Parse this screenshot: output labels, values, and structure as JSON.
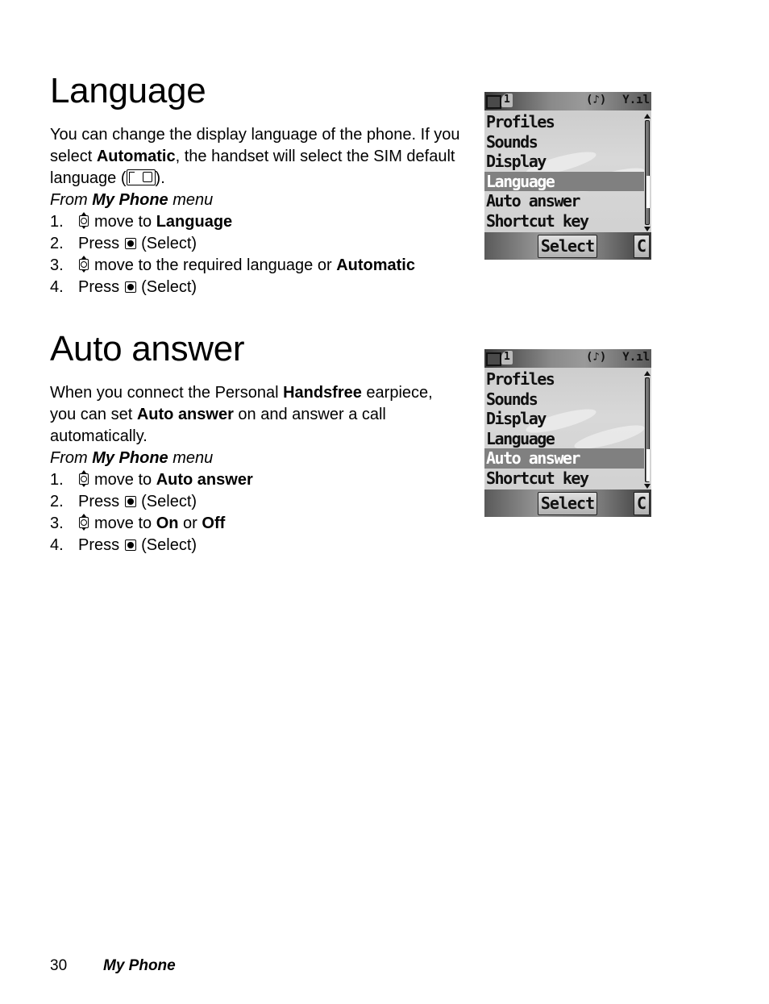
{
  "sections": [
    {
      "title": "Language",
      "intro": [
        {
          "text": "You can change the display language of the phone. If you select "
        },
        {
          "text": "Automatic",
          "bold": true
        },
        {
          "text": ", the handset will select the SIM default language ("
        },
        {
          "icon": "sim-card-icon"
        },
        {
          "text": ")."
        }
      ],
      "from": {
        "prefix": "From ",
        "menu": "My Phone",
        "suffix": " menu"
      },
      "steps": [
        {
          "num": "1.",
          "icon": "navigation-key-icon",
          "text": "move to ",
          "bold": "Language"
        },
        {
          "num": "2.",
          "prefix": "Press",
          "icon": "select-key-icon",
          "text": "(Select)"
        },
        {
          "num": "3.",
          "icon": "navigation-key-icon",
          "text": "move to the required language or ",
          "bold": "Automatic"
        },
        {
          "num": "4.",
          "prefix": "Press",
          "icon": "select-key-icon",
          "text": "(Select)"
        }
      ],
      "screen": {
        "menu_items": [
          "Profiles",
          "Sounds",
          "Display",
          "Language",
          "Auto answer",
          "Shortcut key"
        ],
        "selected_index": 3,
        "softkey_left": "Select",
        "softkey_right": "C",
        "status_line": "1"
      }
    },
    {
      "title": "Auto answer",
      "intro": [
        {
          "text": "When you connect the Personal "
        },
        {
          "text": "Handsfree",
          "bold": true
        },
        {
          "text": " earpiece, you can set "
        },
        {
          "text": "Auto answer",
          "bold": true
        },
        {
          "text": " on and answer a call automatically."
        }
      ],
      "from": {
        "prefix": "From ",
        "menu": "My Phone",
        "suffix": " menu"
      },
      "steps": [
        {
          "num": "1.",
          "icon": "navigation-key-icon",
          "text": "move to ",
          "bold": "Auto answer"
        },
        {
          "num": "2.",
          "prefix": "Press",
          "icon": "select-key-icon",
          "text": "(Select)"
        },
        {
          "num": "3.",
          "icon": "navigation-key-icon",
          "text": "move to ",
          "bold": "On",
          "text2": " or ",
          "bold2": "Off"
        },
        {
          "num": "4.",
          "prefix": "Press",
          "icon": "select-key-icon",
          "text": "(Select)"
        }
      ],
      "screen": {
        "menu_items": [
          "Profiles",
          "Sounds",
          "Display",
          "Language",
          "Auto answer",
          "Shortcut key"
        ],
        "selected_index": 4,
        "softkey_left": "Select",
        "softkey_right": "C",
        "status_line": "1"
      }
    }
  ],
  "footer": {
    "page_number": "30",
    "chapter": "My Phone"
  }
}
